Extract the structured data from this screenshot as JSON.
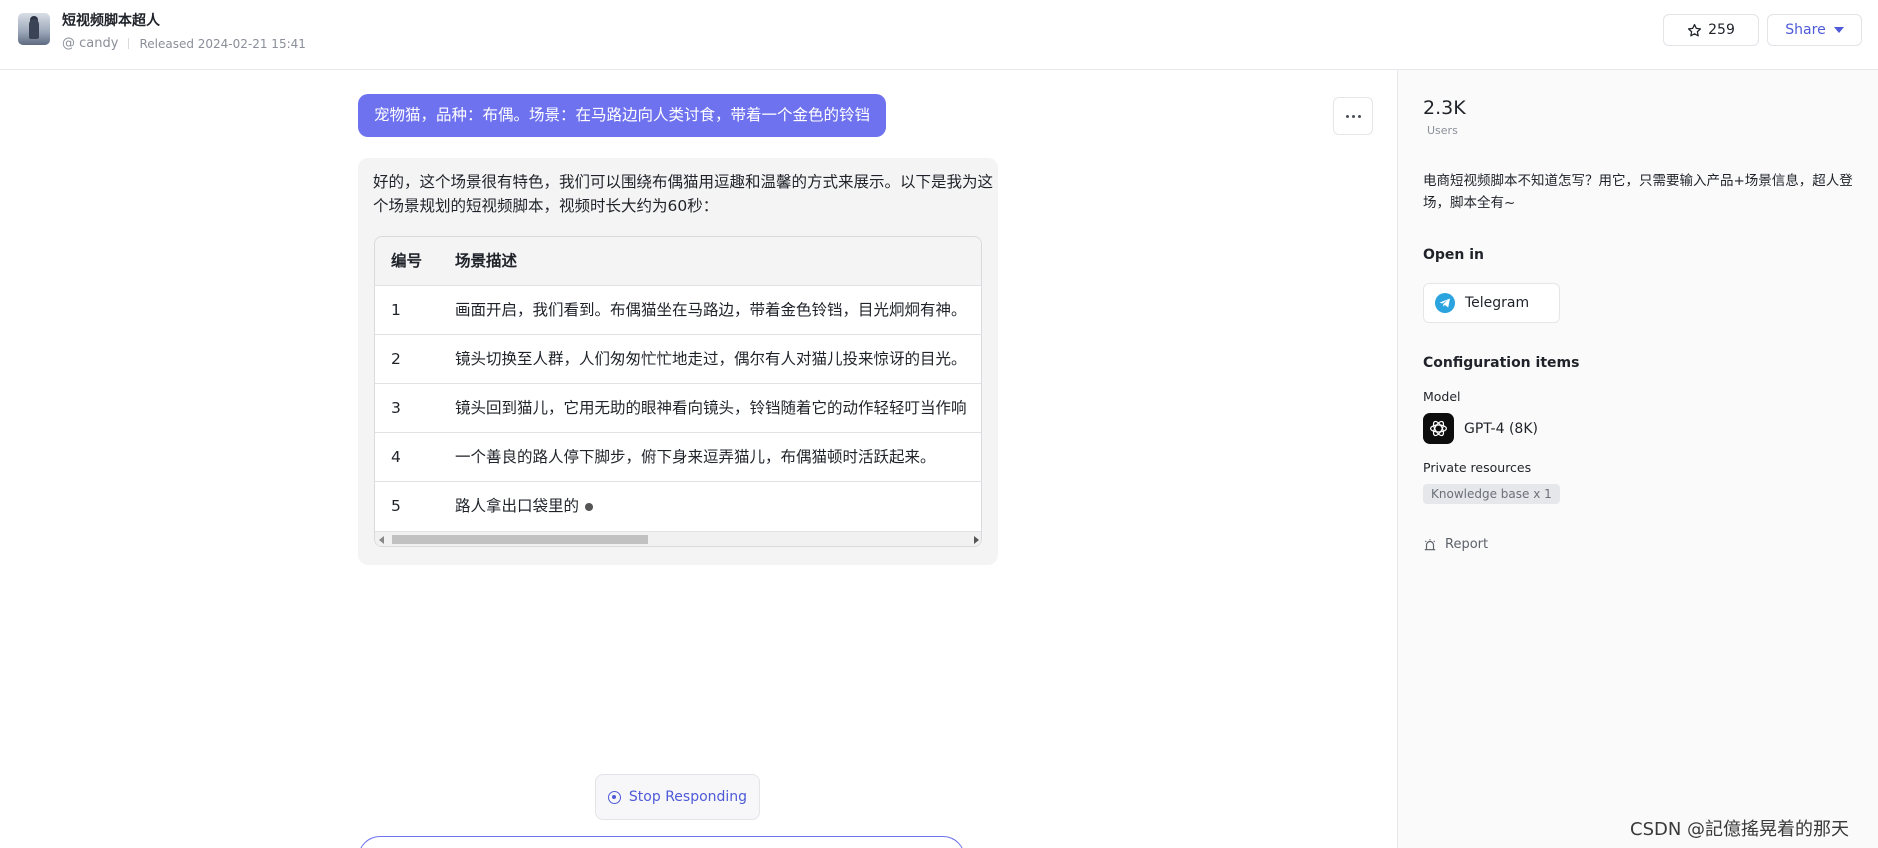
{
  "app": {
    "title": "短视频脚本超人",
    "author": "@ candy",
    "released": "Released 2024-02-21 15:41",
    "star_count": "259",
    "share_label": "Share"
  },
  "chat": {
    "user_message": "宠物猫，品种：布偶。场景：在马路边向人类讨食，带着一个金色的铃铛",
    "bot_intro": "好的，这个场景很有特色，我们可以围绕布偶猫用逗趣和温馨的方式来展示。以下是我为这个场景规划的短视频脚本，视频时长大约为60秒：",
    "table": {
      "headers": [
        "编号",
        "场景描述"
      ],
      "rows": [
        [
          "1",
          "画面开启，我们看到。布偶猫坐在马路边，带着金色铃铛，目光炯炯有神。"
        ],
        [
          "2",
          "镜头切换至人群，人们匆匆忙忙地走过，偶尔有人对猫儿投来惊讶的目光。"
        ],
        [
          "3",
          "镜头回到猫儿，它用无助的眼神看向镜头，铃铛随着它的动作轻轻叮当作响"
        ],
        [
          "4",
          "一个善良的路人停下脚步，俯下身来逗弄猫儿，布偶猫顿时活跃起来。"
        ],
        [
          "5",
          "路人拿出口袋里的"
        ]
      ]
    },
    "stop_label": "Stop Responding"
  },
  "panel": {
    "users_count": "2.3K",
    "users_label": "Users",
    "description": "电商短视频脚本不知道怎写？用它，只需要输入产品+场景信息，超人登场，脚本全有~",
    "open_in_title": "Open in",
    "telegram_label": "Telegram",
    "config_title": "Configuration items",
    "model_label": "Model",
    "model_name": "GPT-4 (8K)",
    "private_label": "Private resources",
    "kb_badge": "Knowledge base x 1",
    "report_label": "Report"
  },
  "watermark": "CSDN @記億搖晃着的那天",
  "colors": {
    "accent": "#6f72ee",
    "link": "#4e5ad8",
    "telegram": "#2aa3df"
  }
}
